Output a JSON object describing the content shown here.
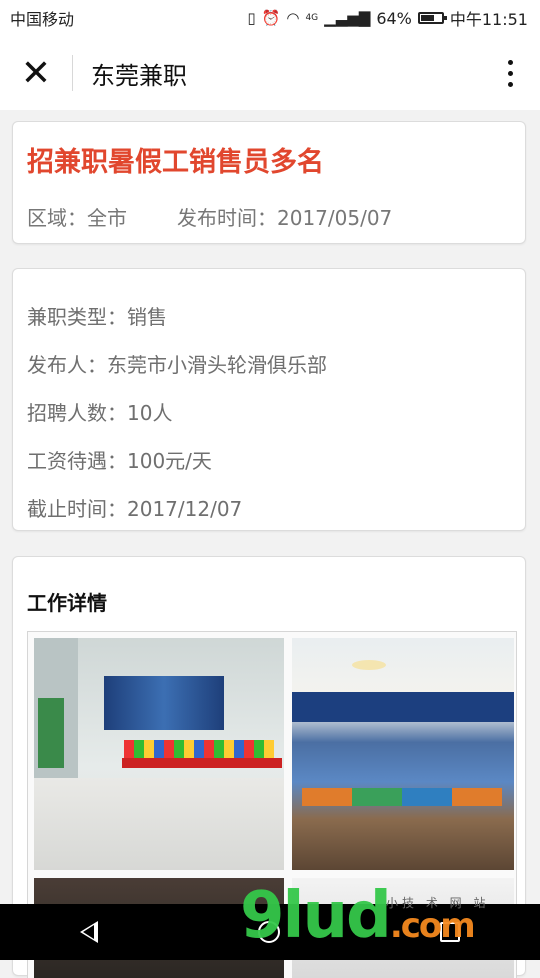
{
  "status_bar": {
    "carrier": "中国移动",
    "network": "4G",
    "battery": "64%",
    "battery_level": 0.64,
    "time": "中午11:51"
  },
  "title_bar": {
    "title": "东莞兼职"
  },
  "job_header": {
    "title": "招兼职暑假工销售员多名",
    "area": "区域：全市",
    "publish_time": "发布时间：2017/05/07"
  },
  "job_info": {
    "type": "兼职类型：销售",
    "publisher": "发布人：东莞市小滑头轮滑俱乐部",
    "headcount": "招聘人数：10人",
    "salary": "工资待遇：100元/天",
    "deadline": "截止时间：2017/12/07"
  },
  "details": {
    "section_title": "工作详情"
  },
  "photos": [
    {
      "name": "mall-atrium-photo"
    },
    {
      "name": "roller-club-photo"
    },
    {
      "name": "ceiling-photo"
    },
    {
      "name": "interior-photo"
    }
  ],
  "watermark": {
    "brand": "9lud",
    "suffix": ".com",
    "sub": "小技 术 网 站"
  },
  "colors": {
    "accent": "#e1472e",
    "watermark_green": "#35c84a",
    "watermark_orange": "#f58a1f"
  },
  "icons": [
    "close-icon",
    "more-icon",
    "vibrate-icon",
    "alarm-icon",
    "wifi-icon",
    "signal-icon",
    "battery-icon",
    "back-icon",
    "home-icon",
    "recent-apps-icon"
  ]
}
